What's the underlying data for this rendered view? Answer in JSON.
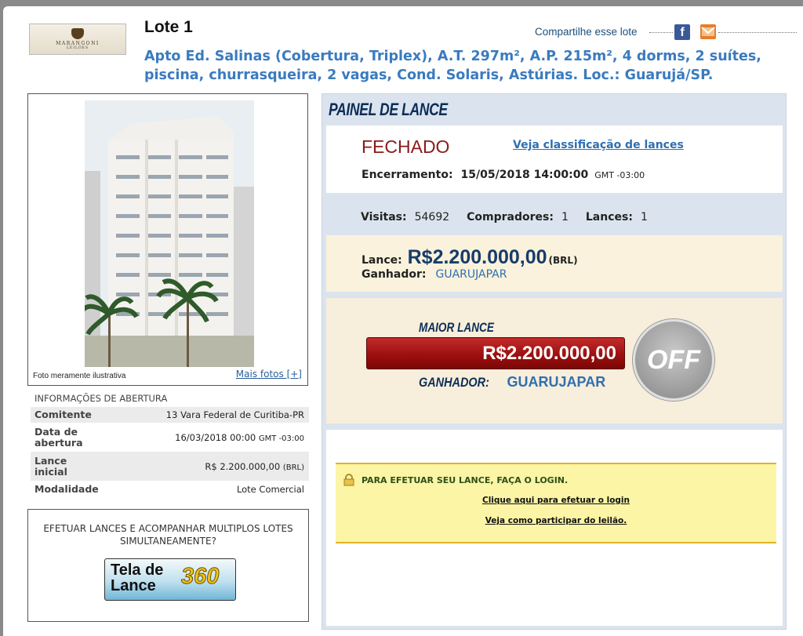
{
  "header": {
    "logo_name": "MARANGONI",
    "logo_sub": "LEILÕES",
    "lot_title": "Lote 1",
    "share_label": "Compartilhe esse lote",
    "description": "Apto Ed. Salinas (Cobertura, Triplex), A.T. 297m², A.P. 215m², 4 dorms, 2 suítes, piscina, churrasqueira, 2 vagas, Cond. Solaris, Astúrias. Loc.: Guarujá/SP."
  },
  "photo": {
    "caption": "Foto meramente ilustrativa",
    "more_link": "Mais fotos [+]"
  },
  "info": {
    "heading": "INFORMAÇÕES DE ABERTURA",
    "rows": [
      {
        "key": "Comitente",
        "value": "13 Vara Federal de Curitiba-PR"
      },
      {
        "key": "Data de abertura",
        "value": "16/03/2018 00:00",
        "suffix": "GMT -03:00"
      },
      {
        "key": "Lance inicial",
        "value": "R$ 2.200.000,00",
        "suffix": "(BRL)"
      },
      {
        "key": "Modalidade",
        "value": "Lote Comercial"
      }
    ]
  },
  "promo": {
    "text": "EFETUAR LANCES E ACOMPANHAR MULTIPLOS LOTES SIMULTANEAMENTE?",
    "button_line1": "Tela de",
    "button_line2": "Lance",
    "button_badge": "360"
  },
  "panel": {
    "title": "PAINEL DE LANCE",
    "status": "FECHADO",
    "ranking_link": "Veja classificação de lances",
    "closing_label": "Encerramento:",
    "closing_datetime": "15/05/2018 14:00:00",
    "closing_tz": "GMT -03:00",
    "visits_label": "Visitas:",
    "visits_value": "54692",
    "buyers_label": "Compradores:",
    "buyers_value": "1",
    "bids_label": "Lances:",
    "bids_value": "1",
    "bid_label": "Lance:",
    "bid_amount": "R$2.200.000,00",
    "bid_currency": "(BRL)",
    "winner_label": "Ganhador:",
    "winner_value": "GUARUJAPAR",
    "highest_label": "MAIOR LANCE",
    "highest_amount": "R$2.200.000,00",
    "highest_winner_label": "GANHADOR:",
    "highest_winner_value": "GUARUJAPAR",
    "off_label": "OFF",
    "login_message": "PARA EFETUAR SEU LANCE, FAÇA O LOGIN.",
    "login_link": "Clique aqui para efetuar o login",
    "howto_link": "Veja como participar do leilão."
  },
  "colors": {
    "accent_blue": "#3a7bbf",
    "status_red": "#8b1a1a",
    "bid_bar": "#9a0e0e"
  }
}
